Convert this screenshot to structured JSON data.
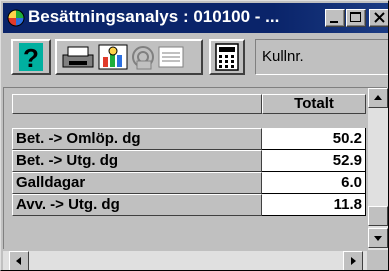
{
  "window": {
    "title": "Besättningsanalys : 010100 - ...",
    "icon": "color-circles-icon",
    "controls": [
      "minimize-icon",
      "maximize-icon",
      "close-icon"
    ]
  },
  "toolbar": {
    "buttons": [
      "help-icon",
      "printer-icon",
      "chart-icon",
      "disk-icon",
      "report-icon",
      "calculator-icon"
    ],
    "kull_label": "Kullnr."
  },
  "grid": {
    "column_header": "Totalt",
    "rows": [
      {
        "label": "Bet. -> Omlöp. dg",
        "value": "50.2"
      },
      {
        "label": "Bet. -> Utg. dg",
        "value": "52.9"
      },
      {
        "label": "Galldagar",
        "value": "6.0"
      },
      {
        "label": "Avv. -> Utg. dg",
        "value": "11.8"
      }
    ]
  },
  "colors": {
    "titlebar": "#0a246a",
    "face": "#c0c0c0",
    "cell": "#ffffff"
  }
}
